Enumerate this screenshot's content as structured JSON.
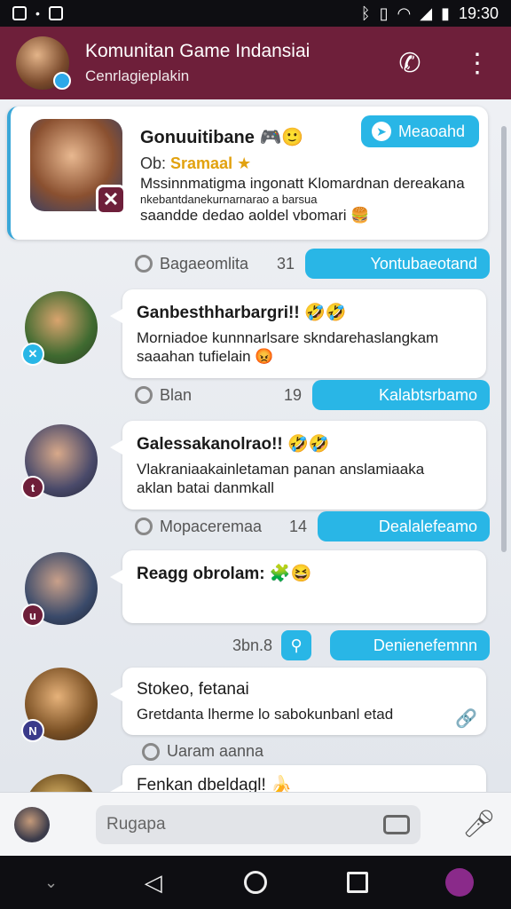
{
  "status_bar": {
    "time": "19:30",
    "icons": [
      "app-icon",
      "dot-icon",
      "photo-icon",
      "bluetooth-icon",
      "vibrate-icon",
      "wifi-icon",
      "signal-icon",
      "battery-icon"
    ]
  },
  "header": {
    "title": "Komunitan Game Indansiai",
    "subtitle": "Cenrlagieplakin",
    "actions": [
      "phone-icon",
      "more-vert-icon"
    ]
  },
  "pinned": {
    "title": "Gonuuitibane",
    "role_prefix": "Ob:",
    "role": "Sramaal",
    "text_line1": "Mssinnmatigma ingonatt Klomardnan dereakana",
    "text_line2": "nkebantdanekurnarnarao a barsua",
    "text_line3": "saandde dedao aoldel vbomari",
    "button_label": "Meaoahd"
  },
  "meta_rows": [
    {
      "name": "Bagaeomlita",
      "count": "31",
      "pill": "Yontubaeotand"
    },
    {
      "name": "Blan",
      "count": "19",
      "pill": "Kalabtsrbamo"
    },
    {
      "name": "Mopaceremaa",
      "count": "14",
      "pill": "Dealalefeamo"
    },
    {
      "name": "3bn.8",
      "count": "",
      "pill": "Denienefemnn"
    }
  ],
  "messages": [
    {
      "title": "Ganbesthharbargri!!",
      "text_line1": "Morniadoe kunnnarlsare skndarehaslangkam",
      "text_line2": "saaahan tufielain"
    },
    {
      "title": "Galessakanolrao!!",
      "text_line1": "Vlakraniaakainletaman panan anslamiaaka",
      "text_line2": "aklan batai danmkall"
    },
    {
      "title": "Reagg obrolam:",
      "text_line1": "",
      "text_line2": ""
    },
    {
      "title": "Stokeo, fetanai",
      "text_line1": "Gretdanta lherme lo sabokunbanl etad",
      "text_line2": ""
    },
    {
      "title": "Fenkan dbeldagl!",
      "text_line1": "",
      "text_line2": ""
    }
  ],
  "last_meta": "Uaram aanna",
  "composer": {
    "placeholder": "Rugapa"
  },
  "colors": {
    "header": "#6e1f3a",
    "accent": "#29b6e6",
    "status_bar": "#0e0e12"
  }
}
